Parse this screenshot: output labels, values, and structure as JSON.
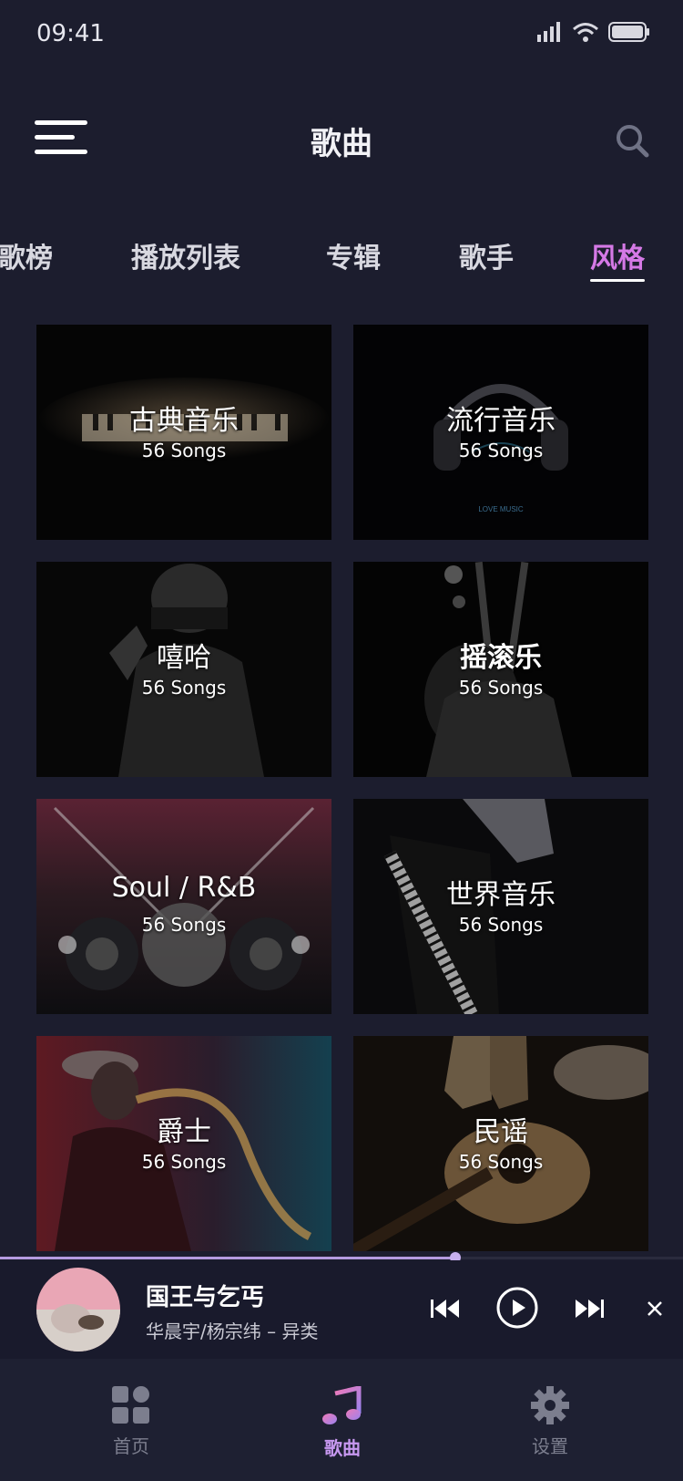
{
  "status_bar": {
    "time": "09:41"
  },
  "header": {
    "title": "歌曲"
  },
  "tabs": [
    {
      "label": "歌榜",
      "active": false
    },
    {
      "label": "播放列表",
      "active": false
    },
    {
      "label": "专辑",
      "active": false
    },
    {
      "label": "歌手",
      "active": false
    },
    {
      "label": "风格",
      "active": true
    }
  ],
  "genres": [
    {
      "title": "古典音乐",
      "count": "56 Songs",
      "art": "piano-keys"
    },
    {
      "title": "流行音乐",
      "count": "56 Songs",
      "art": "headphones"
    },
    {
      "title": "嘻哈",
      "count": "56 Songs",
      "art": "rapper"
    },
    {
      "title": "摇滚乐",
      "count": "56 Songs",
      "art": "guitarist"
    },
    {
      "title": "Soul / R&B",
      "count": "56 Songs",
      "art": "speakers-stage"
    },
    {
      "title": "世界音乐",
      "count": "56 Songs",
      "art": "grand-piano"
    },
    {
      "title": "爵士",
      "count": "56 Songs",
      "art": "saxophone"
    },
    {
      "title": "民谣",
      "count": "56 Songs",
      "art": "acoustic-guitar"
    }
  ],
  "player": {
    "song": "国王与乞丐",
    "artist": "华晨宇/杨宗纬 – 异类",
    "progress": 0.667
  },
  "bottom_nav": [
    {
      "label": "首页",
      "icon": "grid-icon",
      "active": false
    },
    {
      "label": "歌曲",
      "icon": "music-note-icon",
      "active": true
    },
    {
      "label": "设置",
      "icon": "gear-icon",
      "active": false
    }
  ],
  "colors": {
    "background": "#1c1d2e",
    "accent": "#d579e6",
    "progress": "#b59be0",
    "nav_inactive": "#7c7e8e"
  }
}
